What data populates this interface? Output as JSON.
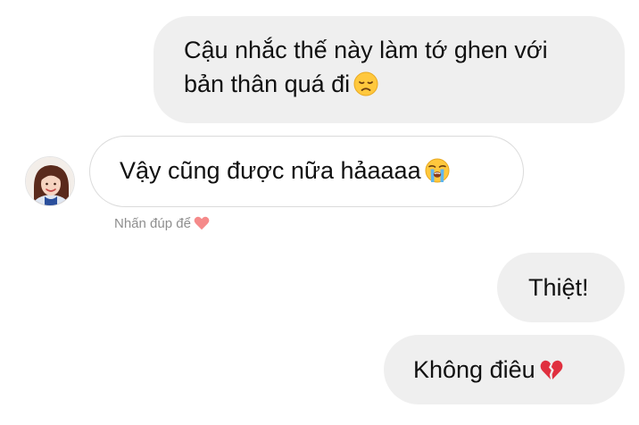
{
  "messages": [
    {
      "sender": "me",
      "line1": "Cậu nhắc thế này làm tớ ghen với",
      "line2": "bản thân quá đi",
      "emoji": "disappointed-face-emoji"
    },
    {
      "sender": "them",
      "text": "Vậy cũng được nữa hảaaaa",
      "emoji": "loudly-crying-face-emoji"
    },
    {
      "sender": "me",
      "text": "Thiệt!"
    },
    {
      "sender": "me",
      "text": "Không điêu",
      "emoji": "broken-heart-emoji"
    }
  ],
  "reaction_hint": {
    "text": "Nhấn đúp để",
    "icon": "heart-icon",
    "icon_color": "#f58a8a"
  },
  "avatar": {
    "icon": "profile-avatar"
  },
  "colors": {
    "sent_bubble": "#efefef",
    "received_border": "#dbdbdb",
    "hint_text": "#8e8e8e"
  }
}
